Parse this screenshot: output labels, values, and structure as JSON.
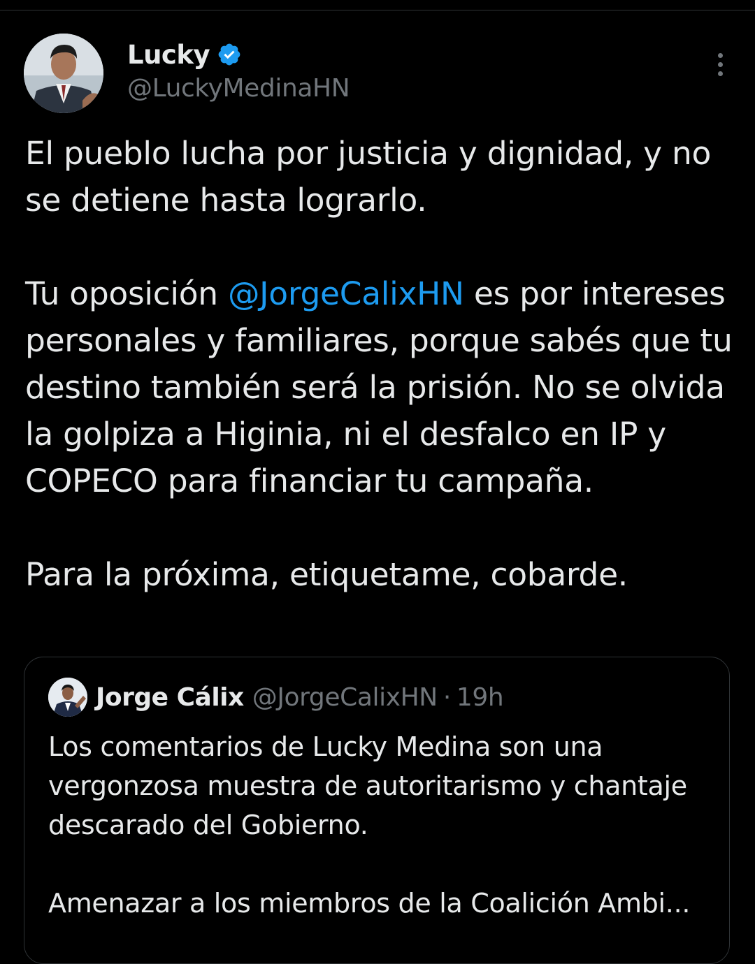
{
  "tweet": {
    "author": {
      "display_name": "Lucky",
      "handle": "@LuckyMedinaHN",
      "verified": true,
      "avatar_icon": "profile-photo"
    },
    "more_icon": "more-options-icon",
    "paragraphs": {
      "p1": "El pueblo lucha por justicia y dignidad, y no se detiene hasta lograrlo.",
      "p2_before": "Tu oposición ",
      "p2_mention": "@JorgeCalixHN",
      "p2_after": " es por intereses personales y familiares, porque sabés que tu destino también será la prisión. No se olvida la golpiza a Higinia, ni el desfalco en IP y COPECO para financiar tu campaña.",
      "p3": "Para la próxima, etiquetame, cobarde."
    },
    "quoted": {
      "display_name": "Jorge Cálix",
      "handle": "@JorgeCalixHN",
      "separator": "·",
      "time": "19h",
      "p1": "Los comentarios de Lucky Medina son una vergonzosa muestra de autoritarismo y chantaje descarado del Gobierno.",
      "p2": "Amenazar a los miembros de la Coalición Ambi..."
    }
  },
  "colors": {
    "background": "#000000",
    "text": "#e7e9ea",
    "secondary": "#71767b",
    "accent": "#1d9bf0",
    "border": "#2f3336"
  }
}
